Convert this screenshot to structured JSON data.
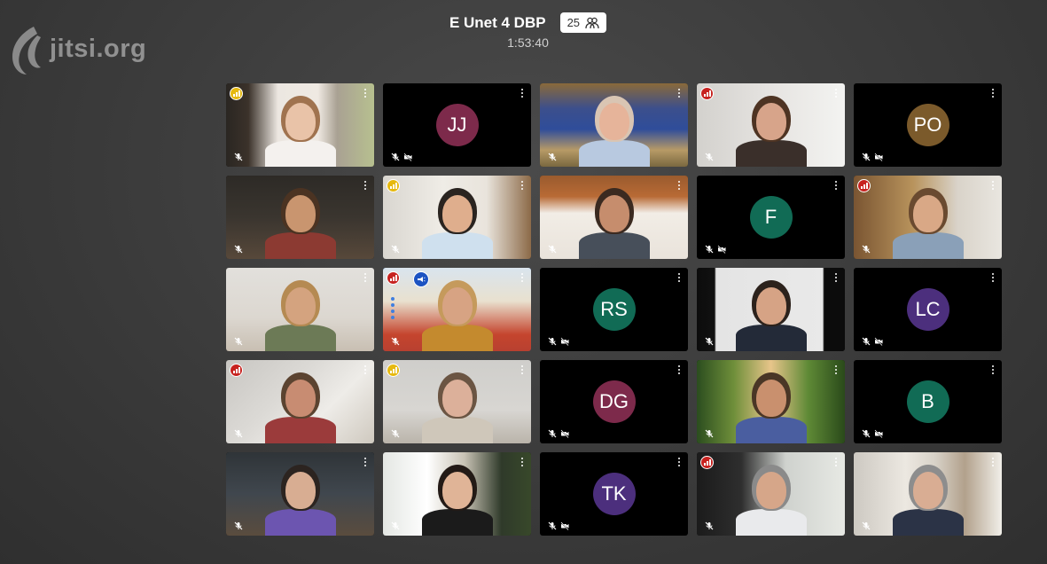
{
  "app": {
    "logo_text": "jitsi.org"
  },
  "header": {
    "title": "E Unet 4 DBP",
    "participant_count": "25",
    "timer": "1:53:40"
  },
  "colors": {
    "active_border": "#1a5dc6",
    "conn_red": "#c7221f",
    "conn_yellow": "#e6b90f"
  },
  "tiles": [
    {
      "initials": "",
      "avatar_color": "",
      "bg": "linear-gradient(90deg,#2a2622 0%,#3b322a 15%,#ece7e1 35%,#efe9e2 62%,#a9a193 75%,#b7c08f 100%)",
      "skin": "#e9c3a8",
      "hair": "#a0734f",
      "shirt": "#f4f1ee",
      "conn": "yellow",
      "video_muted": false
    },
    {
      "initials": "JJ",
      "avatar_color": "#7d2a4b",
      "conn": "",
      "video_muted": true
    },
    {
      "initials": "",
      "avatar_color": "",
      "bg": "linear-gradient(180deg,#8a6a3a 0%,#3c4f8c 30%,#2f4d9a 55%,#b79a66 80%,#7a6840 100%)",
      "skin": "#e6b49a",
      "hair": "#d9c5b3",
      "shirt": "#b8c9e0",
      "conn": "",
      "video_muted": false
    },
    {
      "initials": "",
      "avatar_color": "",
      "bg": "linear-gradient(90deg,#d3d1cd 0%,#e6e4e1 50%,#f3f3f1 100%)",
      "skin": "#d7a48a",
      "hair": "#4e3423",
      "shirt": "#3a2f2a",
      "conn": "red",
      "video_muted": false
    },
    {
      "initials": "PO",
      "avatar_color": "#7b5a2b",
      "conn": "",
      "video_muted": true
    },
    {
      "initials": "",
      "avatar_color": "",
      "bg": "linear-gradient(180deg,#2d2a26 0%,#3a352f 50%,#57483a 100%)",
      "skin": "#c9956f",
      "hair": "#4b3322",
      "shirt": "#8c3a32",
      "conn": "",
      "video_muted": false
    },
    {
      "initials": "",
      "avatar_color": "",
      "bg": "linear-gradient(90deg,#d9d6d0 0%,#efece6 40%,#e9e4dc 70%,#8c6a48 100%)",
      "skin": "#dfae8d",
      "hair": "#2a2420",
      "shirt": "#cfe0ee",
      "conn": "yellow",
      "video_muted": false
    },
    {
      "initials": "",
      "avatar_color": "",
      "bg": "linear-gradient(180deg,#9a5b2e 0%,#b86a35 25%,#f2ede6 45%,#e9e3db 100%)",
      "skin": "#c68d6d",
      "hair": "#3b2a20",
      "shirt": "#474f5a",
      "conn": "",
      "video_muted": false
    },
    {
      "initials": "F",
      "avatar_color": "#116b55",
      "conn": "",
      "video_muted": true
    },
    {
      "initials": "",
      "avatar_color": "",
      "bg": "linear-gradient(90deg,#7a5532 0%,#b8935c 40%,#d9d3c9 70%,#e9e6e0 100%)",
      "skin": "#d9a886",
      "hair": "#6a4a30",
      "shirt": "#8aa0b8",
      "conn": "red",
      "video_muted": false
    },
    {
      "initials": "",
      "avatar_color": "",
      "bg": "linear-gradient(180deg,#e2e0dc 0%,#dcd7d0 60%,#c8bfb2 100%)",
      "skin": "#d4a37f",
      "hair": "#b58a52",
      "shirt": "#6c7a56",
      "conn": "",
      "video_muted": false
    },
    {
      "initials": "",
      "avatar_color": "",
      "bg": "linear-gradient(180deg,#d9e4ee 0%,#e9e1cf 40%,#c5452e 80%,#b84030 100%)",
      "skin": "#d7a383",
      "hair": "#c59a5c",
      "shirt": "#c48a2e",
      "conn": "red",
      "video_muted": false,
      "active": true,
      "speaker": true
    },
    {
      "initials": "RS",
      "avatar_color": "#116b55",
      "conn": "",
      "video_muted": true
    },
    {
      "initials": "",
      "avatar_color": "",
      "bg": "linear-gradient(90deg,#0c0c0c 0%,#111 12%,#e4e4e4 13%,#e9e9e9 85%,#0c0c0c 86%)",
      "skin": "#d6a385",
      "hair": "#2c221c",
      "shirt": "#232a38",
      "conn": "",
      "video_muted": false
    },
    {
      "initials": "LC",
      "avatar_color": "#4c2f7d",
      "conn": "",
      "video_muted": true
    },
    {
      "initials": "",
      "avatar_color": "",
      "bg": "linear-gradient(135deg,#c8c6c2 0%,#dcdad6 40%,#eeece8 65%,#cfc9bf 100%)",
      "skin": "#c88c72",
      "hair": "#5b4330",
      "shirt": "#9b3b3b",
      "conn": "red",
      "video_muted": false
    },
    {
      "initials": "",
      "avatar_color": "",
      "bg": "linear-gradient(180deg,#cfcecb 0%,#d8d6d2 60%,#bab4aa 100%)",
      "skin": "#dcb09a",
      "hair": "#6b5543",
      "shirt": "#cfc7ba",
      "conn": "yellow",
      "video_muted": false
    },
    {
      "initials": "DG",
      "avatar_color": "#7d2a4b",
      "conn": "",
      "video_muted": true
    },
    {
      "initials": "",
      "avatar_color": "",
      "bg": "linear-gradient(90deg,#2b4d1f 0%,#6f8f3a 25%,#e7c58a 50%,#5f8a36 75%,#2a4a1a 100%)",
      "skin": "#c9906e",
      "hair": "#4a3626",
      "shirt": "#4a5ea0",
      "conn": "",
      "video_muted": false
    },
    {
      "initials": "B",
      "avatar_color": "#116b55",
      "conn": "",
      "video_muted": true
    },
    {
      "initials": "",
      "avatar_color": "",
      "bg": "linear-gradient(180deg,#2f3438 0%,#40474e 50%,#5a4c3e 100%)",
      "skin": "#d8ad92",
      "hair": "#2c2420",
      "shirt": "#6c55b0",
      "conn": "",
      "video_muted": false
    },
    {
      "initials": "",
      "avatar_color": "",
      "bg": "linear-gradient(90deg,#e4e7e3 0%,#ffffff 30%,#c9c3b5 55%,#2f3a2a 80%,#38482a 100%)",
      "skin": "#e0b497",
      "hair": "#231a16",
      "shirt": "#1b1b1b",
      "conn": "",
      "video_muted": false
    },
    {
      "initials": "TK",
      "avatar_color": "#4c2f7d",
      "conn": "",
      "video_muted": true
    },
    {
      "initials": "",
      "avatar_color": "",
      "bg": "linear-gradient(90deg,#1b1b1b 0%,#2e2e2e 30%,#cfd2ce 60%,#e7e9e4 100%)",
      "skin": "#d6a689",
      "hair": "#8a8a8a",
      "shirt": "#e9eaec",
      "conn": "red",
      "video_muted": false
    },
    {
      "initials": "",
      "avatar_color": "",
      "bg": "linear-gradient(90deg,#cdc9c2 0%,#ece8e1 35%,#d8d2c8 55%,#b2a18c 75%,#f1efe9 100%)",
      "skin": "#d9ad93",
      "hair": "#8d8d8d",
      "shirt": "#2b3346",
      "conn": "",
      "video_muted": false
    }
  ]
}
